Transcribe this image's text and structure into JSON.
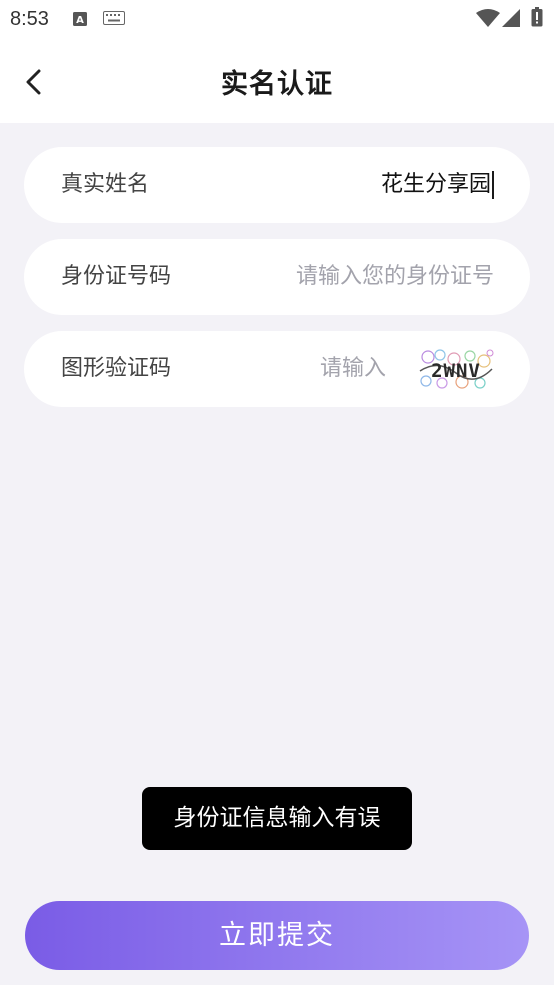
{
  "status_bar": {
    "time": "8:53",
    "icons": [
      "text-input-icon",
      "keyboard-icon",
      "wifi-icon",
      "signal-icon",
      "battery-icon"
    ]
  },
  "header": {
    "title": "实名认证",
    "back_icon": "chevron-left-icon"
  },
  "form": {
    "name": {
      "label": "真实姓名",
      "value": "花生分享园"
    },
    "id_number": {
      "label": "身份证号码",
      "placeholder": "请输入您的身份证号"
    },
    "captcha": {
      "label": "图形验证码",
      "placeholder": "请输入",
      "image_text": "2WNV"
    }
  },
  "toast": {
    "message": "身份证信息输入有误"
  },
  "submit": {
    "label": "立即提交"
  },
  "colors": {
    "background": "#f3f2f7",
    "card": "#ffffff",
    "accent_start": "#7a5ce6",
    "accent_end": "#a694f6",
    "toast_bg": "#000000"
  }
}
